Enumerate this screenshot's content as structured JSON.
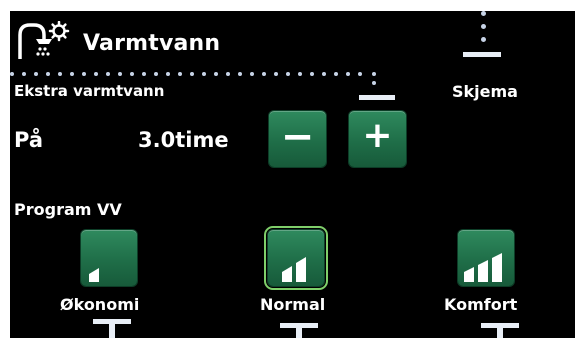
{
  "header": {
    "title": "Varmtvann",
    "icon": "shower-gear-icon"
  },
  "extra_hot_water": {
    "label": "Ekstra varmtvann",
    "state": "På",
    "duration": "3.0time",
    "minus_label": "−",
    "plus_label": "+"
  },
  "schedule": {
    "label": "Skjema"
  },
  "program": {
    "title": "Program VV",
    "options": [
      {
        "label": "Økonomi",
        "icon": "signal-1-bar-icon",
        "selected": false
      },
      {
        "label": "Normal",
        "icon": "signal-2-bars-icon",
        "selected": true
      },
      {
        "label": "Komfort",
        "icon": "signal-3-bars-icon",
        "selected": false
      }
    ]
  },
  "colors": {
    "button": "#1f6e48",
    "selection_border": "#7fcf6a",
    "background": "#000000",
    "text": "#ffffff"
  }
}
